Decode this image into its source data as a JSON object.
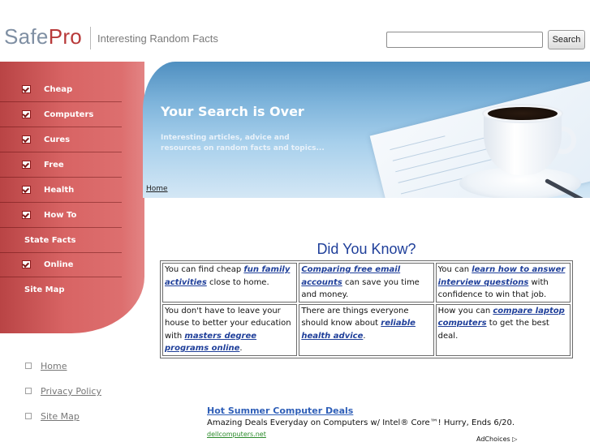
{
  "header": {
    "logo_part1": "Safe",
    "logo_part2": "Pro",
    "tagline": "Interesting Random Facts",
    "search_value": "",
    "search_button": "Search"
  },
  "sidebar": {
    "items": [
      {
        "label": "Cheap",
        "checked": true
      },
      {
        "label": "Computers",
        "checked": true
      },
      {
        "label": "Cures",
        "checked": true
      },
      {
        "label": "Free",
        "checked": true
      },
      {
        "label": "Health",
        "checked": true
      },
      {
        "label": "How To",
        "checked": true
      },
      {
        "label": "State Facts",
        "checked": false
      },
      {
        "label": "Online",
        "checked": true
      },
      {
        "label": "Site Map",
        "checked": false
      }
    ],
    "accent_color": "#c94f50"
  },
  "footer_links": [
    "Home",
    "Privacy Policy",
    "Site Map"
  ],
  "hero": {
    "title": "Your Search is Over",
    "subtitle": "Interesting articles, advice and resources on random facts and topics..."
  },
  "breadcrumb": "Home",
  "did_you_know": {
    "title": "Did You Know?",
    "cells": [
      {
        "pre": "You can find cheap ",
        "link": "fun family activities",
        "post": " close to home."
      },
      {
        "pre": "",
        "link": "Comparing free email accounts",
        "post": " can save you time and money."
      },
      {
        "pre": "You can ",
        "link": "learn how to answer interview questions",
        "post": " with confidence to win that job."
      },
      {
        "pre": "You don't have to leave your house to better your education with ",
        "link": "masters degree programs online",
        "post": "."
      },
      {
        "pre": "There are things everyone should know about ",
        "link": "reliable health advice",
        "post": "."
      },
      {
        "pre": "How you can ",
        "link": "compare laptop computers",
        "post": " to get the best deal."
      }
    ]
  },
  "ad": {
    "title": "Hot Summer Computer Deals",
    "description": "Amazing Deals Everyday on Computers w/ Intel® Core™! Hurry, Ends 6/20.",
    "url": "dellcomputers.net",
    "adchoices": "AdChoices ▷"
  }
}
